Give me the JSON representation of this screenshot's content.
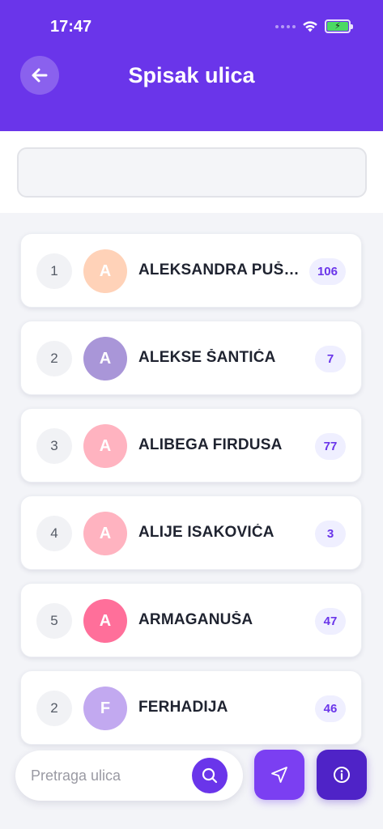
{
  "status_bar": {
    "time": "17:47"
  },
  "header": {
    "title": "Spisak ulica",
    "back_icon": "arrow-left-icon"
  },
  "filter": {
    "value": ""
  },
  "streets": [
    {
      "rank": "1",
      "initial": "A",
      "name": "ALEKSANDRA PUŠK...",
      "count": "106",
      "avatar_color": "#ffd2b8"
    },
    {
      "rank": "2",
      "initial": "A",
      "name": "ALEKSE ŠANTIĆA",
      "count": "7",
      "avatar_color": "#a996d8"
    },
    {
      "rank": "3",
      "initial": "A",
      "name": "ALIBEGA FIRDUSA",
      "count": "77",
      "avatar_color": "#ffb3c0"
    },
    {
      "rank": "4",
      "initial": "A",
      "name": "ALIJE ISAKOVIĆA",
      "count": "3",
      "avatar_color": "#ffb3c0"
    },
    {
      "rank": "5",
      "initial": "A",
      "name": "ARMAGANUŠA",
      "count": "47",
      "avatar_color": "#ff6f9a"
    },
    {
      "rank": "2",
      "initial": "F",
      "name": "FERHADIJA",
      "count": "46",
      "avatar_color": "#c2a9f0"
    }
  ],
  "search": {
    "placeholder": "Pretraga ulica",
    "icon": "search-icon"
  },
  "actions": {
    "navigate_icon": "navigation-arrow-icon",
    "info_icon": "info-icon"
  },
  "colors": {
    "primary": "#6a35ea",
    "badge_bg": "#efefff",
    "info_button": "#4f23c7",
    "nav_button": "#7b3ff2"
  }
}
